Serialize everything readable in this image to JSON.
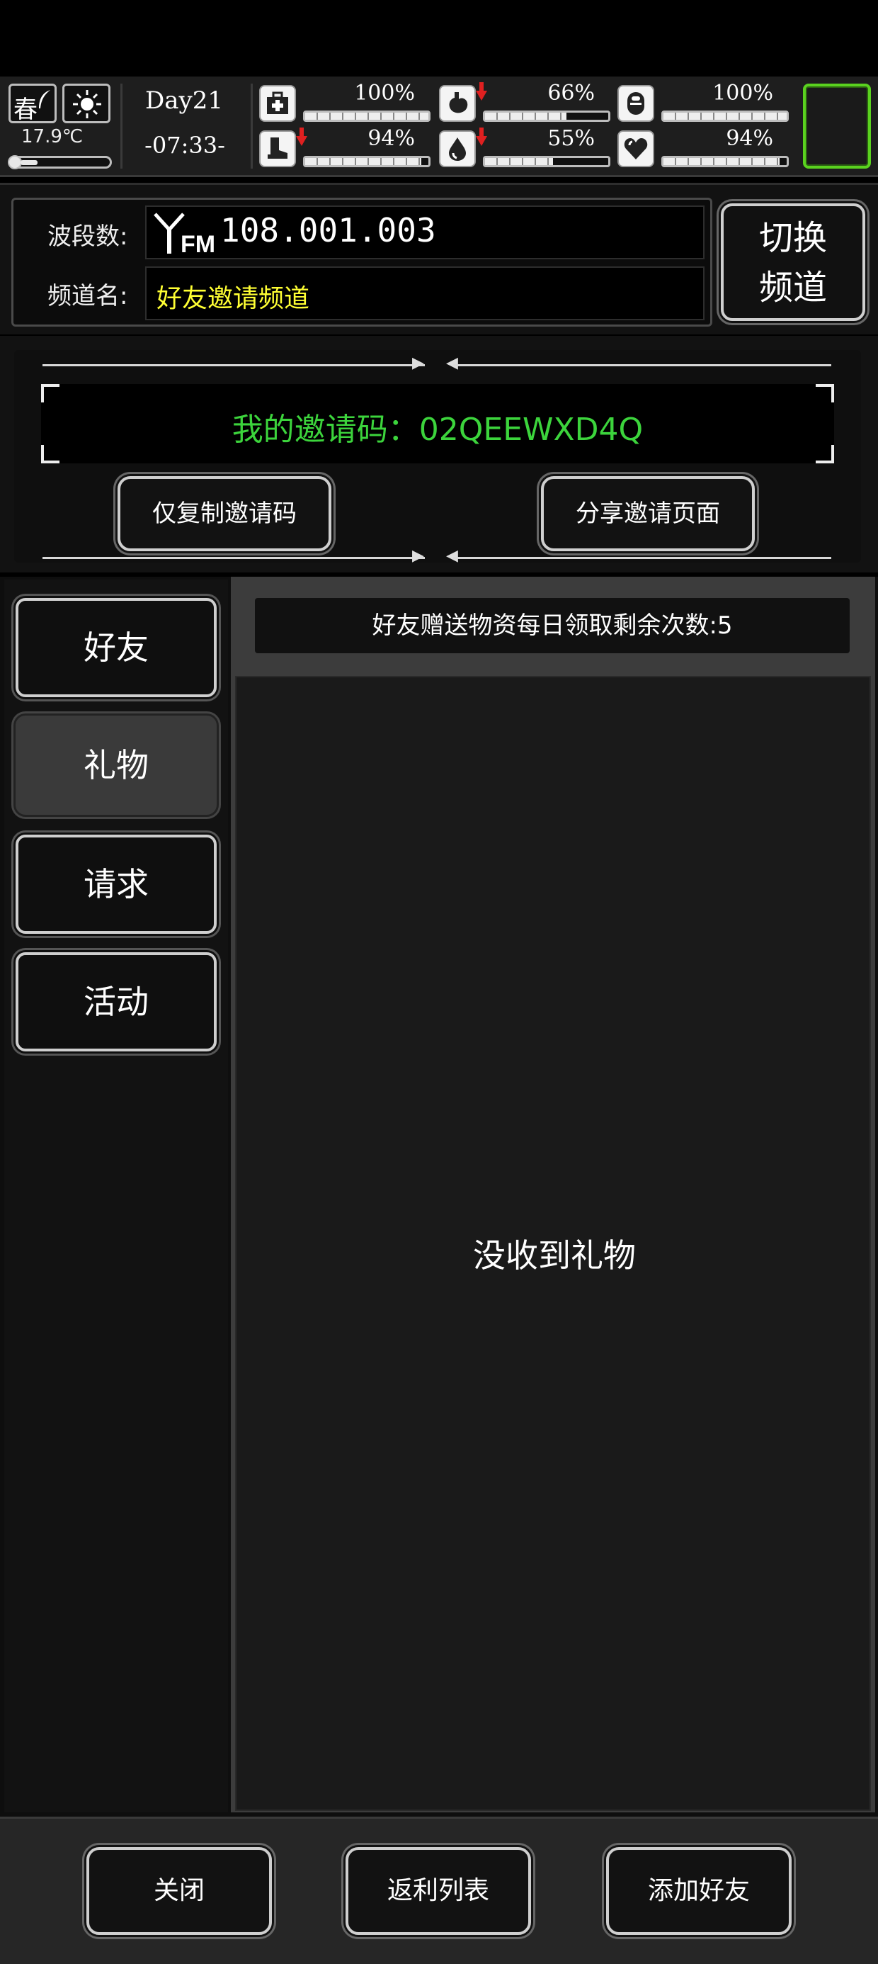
{
  "status": {
    "season": "春",
    "temperature": "17.9℃",
    "temperature_level": 0.2,
    "day": "Day21",
    "time": "-07:33-",
    "stats": [
      {
        "icon": "medkit-icon",
        "value": "100%",
        "level": 1.0,
        "decreasing": false
      },
      {
        "icon": "stomach-icon",
        "value": "66%",
        "level": 0.66,
        "decreasing": true
      },
      {
        "icon": "pill-icon",
        "value": "100%",
        "level": 1.0,
        "decreasing": false
      },
      {
        "icon": "boot-icon",
        "value": "94%",
        "level": 0.94,
        "decreasing": true
      },
      {
        "icon": "water-drop-icon",
        "value": "55%",
        "level": 0.55,
        "decreasing": true
      },
      {
        "icon": "heart-icon",
        "value": "94%",
        "level": 0.94,
        "decreasing": false
      }
    ],
    "accent": "#5ad21f"
  },
  "channel": {
    "freq_label": "波段数:",
    "freq_value": "108.001.003",
    "fm_text": "FM",
    "name_label": "频道名:",
    "name_value": "好友邀请频道",
    "switch_line1": "切换",
    "switch_line2": "频道"
  },
  "invite": {
    "code_text": "我的邀请码：02QEEWXD4Q",
    "copy_button": "仅复制邀请码",
    "share_button": "分享邀请页面",
    "code_color": "#3cd43c"
  },
  "tabs": [
    {
      "label": "好友",
      "active": false
    },
    {
      "label": "礼物",
      "active": true
    },
    {
      "label": "请求",
      "active": false
    },
    {
      "label": "活动",
      "active": false
    }
  ],
  "gifts": {
    "count_text": "好友赠送物资每日领取剩余次数:5",
    "empty_text": "没收到礼物"
  },
  "footer": {
    "close": "关闭",
    "rebate": "返利列表",
    "add_friend": "添加好友"
  }
}
